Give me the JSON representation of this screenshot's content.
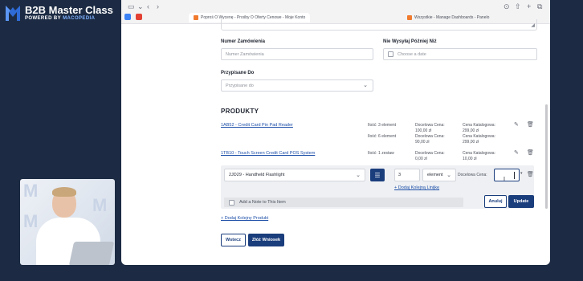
{
  "brand": {
    "title": "B2B Master Class",
    "powered_prefix": "POWERED BY",
    "powered_name": "MACOPEDIA"
  },
  "browser": {
    "tabs": [
      {
        "title": "Poproś O Wycenę - Prośby O Oferty Cenowe - Moje Konto",
        "active": true
      },
      {
        "title": "Wszystkie - Manage Dashboards - Panelo",
        "active": false
      }
    ]
  },
  "form": {
    "order_number_label": "Numer Zamówienia",
    "order_number_placeholder": "Numer Zamówienia",
    "send_by_label": "Nie Wysyłaj Później Niż",
    "send_by_placeholder": "Choose a date",
    "assigned_label": "Przypisane Do",
    "assigned_placeholder": "Przypisane do"
  },
  "products": {
    "title": "PRODUKTY",
    "items": [
      {
        "link": "1AB52 - Credit Card Pin Pad Reader",
        "lines": [
          {
            "qty": "Ilość: 3 element",
            "target_label": "Docelowa Cena:",
            "target": "100,00 zł",
            "catalog_label": "Cena Katalogowa:",
            "catalog": "299,00 zł"
          },
          {
            "qty": "Ilość: 6 element",
            "target_label": "Docelowa Cena:",
            "target": "90,00 zł",
            "catalog_label": "Cena Katalogowa:",
            "catalog": "299,00 zł"
          }
        ]
      },
      {
        "link": "1TB10 - Touch Screen Credit Card POS System",
        "lines": [
          {
            "qty": "Ilość: 1 zestaw",
            "target_label": "Docelowa Cena:",
            "target": "0,00 zł",
            "catalog_label": "Cena Katalogowa:",
            "catalog": "10,00 zł"
          }
        ]
      }
    ],
    "editor": {
      "product_value": "2JD29 - Handheld Flashlight",
      "quantity": "3",
      "unit": "element",
      "target_price_label": "Docelowa Cena:",
      "add_row_link": "+ Dodaj Kolejną Linijkę",
      "note_label": "Add a Note to This Item",
      "cancel_label": "Anuluj",
      "update_label": "Update"
    },
    "add_product_link": "+ Dodaj Kolejny Produkt"
  },
  "actions": {
    "back_label": "Wstecz",
    "submit_label": "Złóż Wniosek"
  }
}
